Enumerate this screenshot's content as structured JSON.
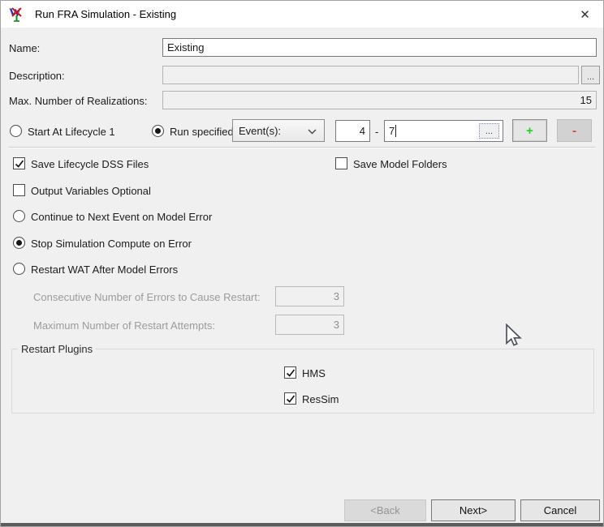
{
  "window": {
    "title": "Run FRA Simulation - Existing",
    "close_glyph": "✕"
  },
  "fields": {
    "name": {
      "label": "Name:",
      "value": "Existing"
    },
    "description": {
      "label": "Description:",
      "value": "",
      "browse_label": "..."
    },
    "max_realizations": {
      "label": "Max. Number of Realizations:",
      "value": "15"
    }
  },
  "run_row": {
    "start_at_lifecycle": {
      "label": "Start At Lifecycle 1",
      "selected": false
    },
    "run_specified": {
      "label": "Run specified",
      "selected": true
    },
    "range_type_selected": "Event(s):",
    "range_from": "4",
    "range_separator": "-",
    "range_to": "7",
    "browse_label": "...",
    "add_label": "+",
    "remove_label": "-"
  },
  "options": {
    "save_lifecycle_dss": {
      "label": "Save Lifecycle DSS Files",
      "checked": true
    },
    "save_model_folders": {
      "label": "Save Model Folders",
      "checked": false
    },
    "output_variables_optional": {
      "label": "Output Variables Optional",
      "checked": false
    }
  },
  "error_handling": [
    {
      "label": "Continue to Next Event on Model Error",
      "selected": false
    },
    {
      "label": "Stop Simulation Compute on Error",
      "selected": true
    },
    {
      "label": "Restart WAT After Model Errors",
      "selected": false
    }
  ],
  "restart_settings": {
    "consecutive_errors": {
      "label": "Consecutive Number of Errors to Cause Restart:",
      "value": "3",
      "enabled": false
    },
    "max_attempts": {
      "label": "Maximum Number of Restart Attempts:",
      "value": "3",
      "enabled": false
    }
  },
  "restart_plugins": {
    "title": "Restart Plugins",
    "items": [
      {
        "label": "HMS",
        "checked": true
      },
      {
        "label": "ResSim",
        "checked": true
      }
    ]
  },
  "footer": {
    "back_label": "<Back",
    "back_enabled": false,
    "next_label": "Next>",
    "cancel_label": "Cancel"
  }
}
